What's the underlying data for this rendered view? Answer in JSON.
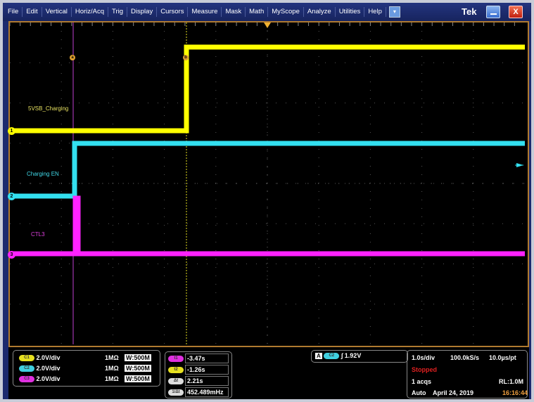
{
  "menu": [
    "File",
    "Edit",
    "Vertical",
    "Horiz/Acq",
    "Trig",
    "Display",
    "Cursors",
    "Measure",
    "Mask",
    "Math",
    "MyScope",
    "Analyze",
    "Utilities",
    "Help"
  ],
  "brand": "Tek",
  "close_label": "X",
  "dropdown_icon": "▾",
  "traces": {
    "ch1": {
      "marker": "1",
      "label": "5VSB_Charging",
      "color": "#ffff00"
    },
    "ch2": {
      "marker": "2",
      "label": "Charging EN",
      "color": "#33e0f0"
    },
    "ch3": {
      "marker": "3",
      "label": "CTL3",
      "color": "#ff22ff"
    }
  },
  "cursor_labels": {
    "a": "a",
    "b": "b"
  },
  "channels": [
    {
      "pill": "C1",
      "scale": "2.0V/div",
      "imp": "1MΩ",
      "bw": "W:500M",
      "color": "#e6e020"
    },
    {
      "pill": "C2",
      "scale": "2.0V/div",
      "imp": "1MΩ",
      "bw": "W:500M",
      "color": "#40d0e0"
    },
    {
      "pill": "C3",
      "scale": "2.0V/div",
      "imp": "1MΩ",
      "bw": "W:500M",
      "color": "#e030e0"
    }
  ],
  "cursors": [
    {
      "pill": "t1",
      "value": "-3.47s",
      "color": "#e030e0"
    },
    {
      "pill": "t2",
      "value": "-1.26s",
      "color": "#e6e020"
    },
    {
      "pill": "Δt",
      "value": "2.21s",
      "color": "#ddd"
    },
    {
      "pill": "1/Δt",
      "value": "452.489mHz",
      "color": "#ddd"
    }
  ],
  "trigger": {
    "source_letter": "A",
    "channel": "C2",
    "slope": "∫",
    "level": "1.92V"
  },
  "acq": {
    "timebase": "1.0s/div",
    "sample_rate": "100.0kS/s",
    "resolution": "10.0µs/pt",
    "state": "Stopped",
    "acqs": "1 acqs",
    "record_length": "RL:1.0M",
    "mode": "Auto",
    "date": "April 24, 2019",
    "time": "16:16:44"
  }
}
